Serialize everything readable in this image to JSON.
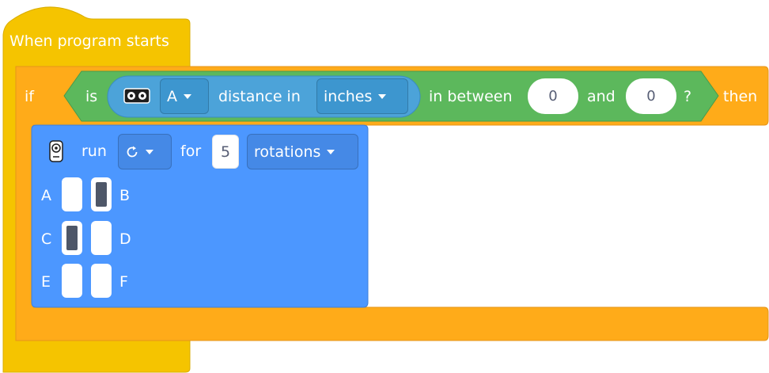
{
  "hat": {
    "label": "When program starts"
  },
  "if_block": {
    "if_label": "if",
    "then_label": "then",
    "condition": {
      "is_label": "is",
      "port": "A",
      "measure_label": "distance in",
      "unit": "inches",
      "between_label": "in between",
      "low": "0",
      "and_label": "and",
      "high": "0",
      "question": "?"
    }
  },
  "run_block": {
    "run_label": "run",
    "direction_icon": "clockwise-arrow-icon",
    "for_label": "for",
    "amount": "5",
    "unit": "rotations",
    "ports": [
      {
        "label": "A",
        "selected": false
      },
      {
        "label": "B",
        "selected": true
      },
      {
        "label": "C",
        "selected": true
      },
      {
        "label": "D",
        "selected": false
      },
      {
        "label": "E",
        "selected": false
      },
      {
        "label": "F",
        "selected": false
      }
    ]
  },
  "colors": {
    "events": "#f5c400",
    "control": "#ffab19",
    "sensor": "#5cb85c",
    "sensor_inner": "#4ca3d9",
    "motor": "#4c97ff"
  }
}
